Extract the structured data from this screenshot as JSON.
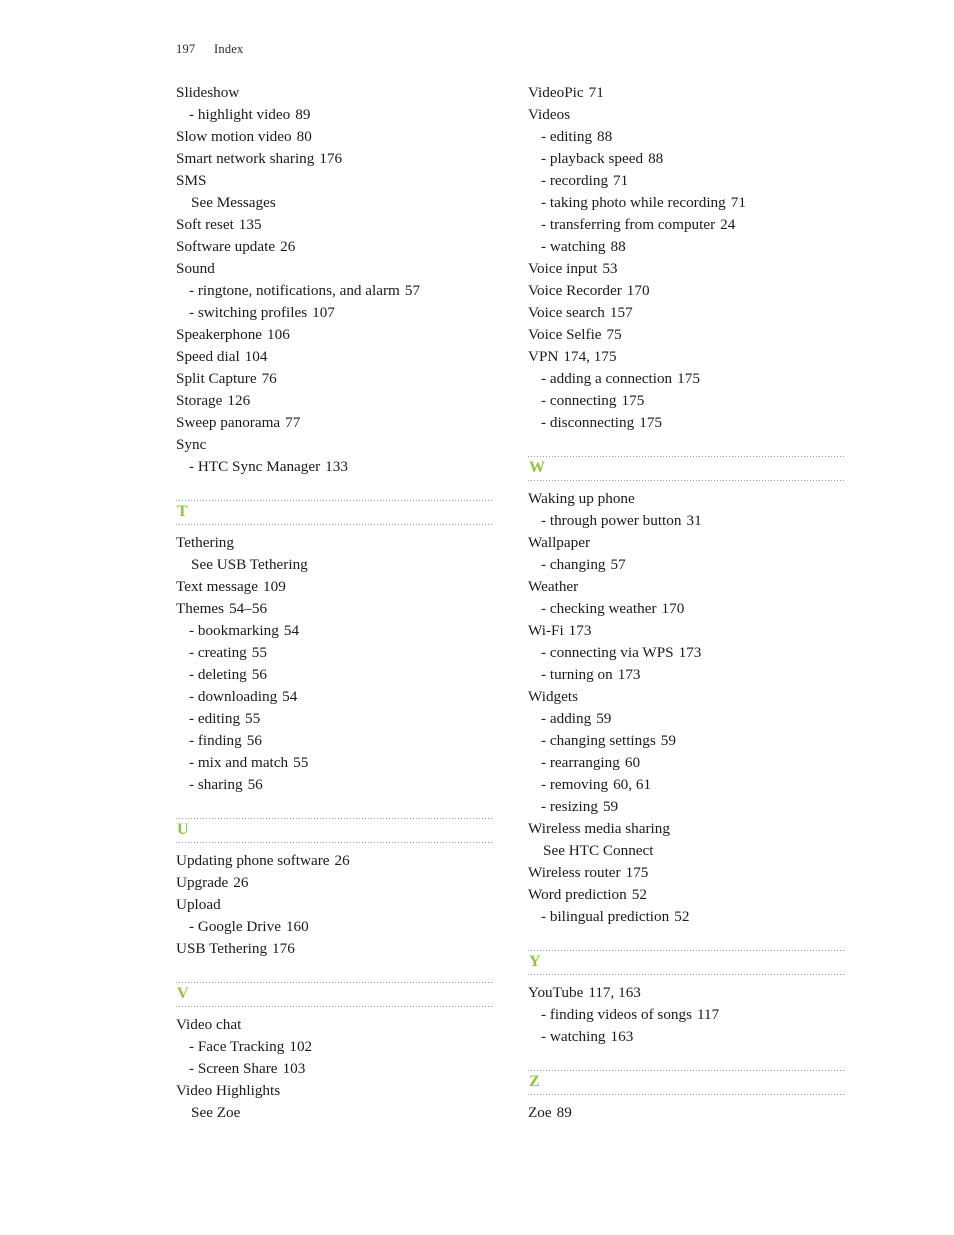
{
  "header": {
    "page_number": "197",
    "title": "Index"
  },
  "theme": {
    "section_letter_color": "#8cc63e",
    "rule_color": "#9a9a9a",
    "text_color": "#1b1b1b"
  },
  "columns": [
    {
      "name": "left-column",
      "sections": [
        {
          "letter": null,
          "entries": [
            {
              "level": "main",
              "text": "Slideshow",
              "pages": ""
            },
            {
              "level": "sub",
              "text": "- highlight video",
              "pages": "89"
            },
            {
              "level": "main",
              "text": "Slow motion video",
              "pages": "80"
            },
            {
              "level": "main",
              "text": "Smart network sharing",
              "pages": "176"
            },
            {
              "level": "main",
              "text": "SMS",
              "pages": ""
            },
            {
              "level": "see",
              "text": "See Messages",
              "pages": ""
            },
            {
              "level": "main",
              "text": "Soft reset",
              "pages": "135"
            },
            {
              "level": "main",
              "text": "Software update",
              "pages": "26"
            },
            {
              "level": "main",
              "text": "Sound",
              "pages": ""
            },
            {
              "level": "sub",
              "text": "- ringtone, notifications, and alarm",
              "pages": "57"
            },
            {
              "level": "sub",
              "text": "- switching profiles",
              "pages": "107"
            },
            {
              "level": "main",
              "text": "Speakerphone",
              "pages": "106"
            },
            {
              "level": "main",
              "text": "Speed dial",
              "pages": "104"
            },
            {
              "level": "main",
              "text": "Split Capture",
              "pages": "76"
            },
            {
              "level": "main",
              "text": "Storage",
              "pages": "126"
            },
            {
              "level": "main",
              "text": "Sweep panorama",
              "pages": "77"
            },
            {
              "level": "main",
              "text": "Sync",
              "pages": ""
            },
            {
              "level": "sub",
              "text": "- HTC Sync Manager",
              "pages": "133"
            }
          ]
        },
        {
          "letter": "T",
          "entries": [
            {
              "level": "main",
              "text": "Tethering",
              "pages": ""
            },
            {
              "level": "see",
              "text": "See USB Tethering",
              "pages": ""
            },
            {
              "level": "main",
              "text": "Text message",
              "pages": "109"
            },
            {
              "level": "main",
              "text": "Themes",
              "pages": "54–56"
            },
            {
              "level": "sub",
              "text": "- bookmarking",
              "pages": "54"
            },
            {
              "level": "sub",
              "text": "- creating",
              "pages": "55"
            },
            {
              "level": "sub",
              "text": "- deleting",
              "pages": "56"
            },
            {
              "level": "sub",
              "text": "- downloading",
              "pages": "54"
            },
            {
              "level": "sub",
              "text": "- editing",
              "pages": "55"
            },
            {
              "level": "sub",
              "text": "- finding",
              "pages": "56"
            },
            {
              "level": "sub",
              "text": "- mix and match",
              "pages": "55"
            },
            {
              "level": "sub",
              "text": "- sharing",
              "pages": "56"
            }
          ]
        },
        {
          "letter": "U",
          "entries": [
            {
              "level": "main",
              "text": "Updating phone software",
              "pages": "26"
            },
            {
              "level": "main",
              "text": "Upgrade",
              "pages": "26"
            },
            {
              "level": "main",
              "text": "Upload",
              "pages": ""
            },
            {
              "level": "sub",
              "text": "- Google Drive",
              "pages": "160"
            },
            {
              "level": "main",
              "text": "USB Tethering",
              "pages": "176"
            }
          ]
        },
        {
          "letter": "V",
          "entries": [
            {
              "level": "main",
              "text": "Video chat",
              "pages": ""
            },
            {
              "level": "sub",
              "text": "- Face Tracking",
              "pages": "102"
            },
            {
              "level": "sub",
              "text": "- Screen Share",
              "pages": "103"
            },
            {
              "level": "main",
              "text": "Video Highlights",
              "pages": ""
            },
            {
              "level": "see",
              "text": "See Zoe",
              "pages": ""
            }
          ]
        }
      ]
    },
    {
      "name": "right-column",
      "sections": [
        {
          "letter": null,
          "entries": [
            {
              "level": "main",
              "text": "VideoPic",
              "pages": "71"
            },
            {
              "level": "main",
              "text": "Videos",
              "pages": ""
            },
            {
              "level": "sub",
              "text": "- editing",
              "pages": "88"
            },
            {
              "level": "sub",
              "text": "- playback speed",
              "pages": "88"
            },
            {
              "level": "sub",
              "text": "- recording",
              "pages": "71"
            },
            {
              "level": "sub",
              "text": "- taking photo while recording",
              "pages": "71"
            },
            {
              "level": "sub",
              "text": "- transferring from computer",
              "pages": "24"
            },
            {
              "level": "sub",
              "text": "- watching",
              "pages": "88"
            },
            {
              "level": "main",
              "text": "Voice input",
              "pages": "53"
            },
            {
              "level": "main",
              "text": "Voice Recorder",
              "pages": "170"
            },
            {
              "level": "main",
              "text": "Voice search",
              "pages": "157"
            },
            {
              "level": "main",
              "text": "Voice Selfie",
              "pages": "75"
            },
            {
              "level": "main",
              "text": "VPN",
              "pages": "174, 175"
            },
            {
              "level": "sub",
              "text": "- adding a connection",
              "pages": "175"
            },
            {
              "level": "sub",
              "text": "- connecting",
              "pages": "175"
            },
            {
              "level": "sub",
              "text": "- disconnecting",
              "pages": "175"
            }
          ]
        },
        {
          "letter": "W",
          "entries": [
            {
              "level": "main",
              "text": "Waking up phone",
              "pages": ""
            },
            {
              "level": "sub",
              "text": "- through power button",
              "pages": "31"
            },
            {
              "level": "main",
              "text": "Wallpaper",
              "pages": ""
            },
            {
              "level": "sub",
              "text": "- changing",
              "pages": "57"
            },
            {
              "level": "main",
              "text": "Weather",
              "pages": ""
            },
            {
              "level": "sub",
              "text": "- checking weather",
              "pages": "170"
            },
            {
              "level": "main",
              "text": "Wi-Fi",
              "pages": "173"
            },
            {
              "level": "sub",
              "text": "- connecting via WPS",
              "pages": "173"
            },
            {
              "level": "sub",
              "text": "- turning on",
              "pages": "173"
            },
            {
              "level": "main",
              "text": "Widgets",
              "pages": ""
            },
            {
              "level": "sub",
              "text": "- adding",
              "pages": "59"
            },
            {
              "level": "sub",
              "text": "- changing settings",
              "pages": "59"
            },
            {
              "level": "sub",
              "text": "- rearranging",
              "pages": "60"
            },
            {
              "level": "sub",
              "text": "- removing",
              "pages": "60, 61"
            },
            {
              "level": "sub",
              "text": "- resizing",
              "pages": "59"
            },
            {
              "level": "main",
              "text": "Wireless media sharing",
              "pages": ""
            },
            {
              "level": "see",
              "text": "See HTC Connect",
              "pages": ""
            },
            {
              "level": "main",
              "text": "Wireless router",
              "pages": "175"
            },
            {
              "level": "main",
              "text": "Word prediction",
              "pages": "52"
            },
            {
              "level": "sub",
              "text": "- bilingual prediction",
              "pages": "52"
            }
          ]
        },
        {
          "letter": "Y",
          "entries": [
            {
              "level": "main",
              "text": "YouTube",
              "pages": "117, 163"
            },
            {
              "level": "sub",
              "text": "- finding videos of songs",
              "pages": "117"
            },
            {
              "level": "sub",
              "text": "- watching",
              "pages": "163"
            }
          ]
        },
        {
          "letter": "Z",
          "entries": [
            {
              "level": "main",
              "text": "Zoe",
              "pages": "89"
            }
          ]
        }
      ]
    }
  ]
}
